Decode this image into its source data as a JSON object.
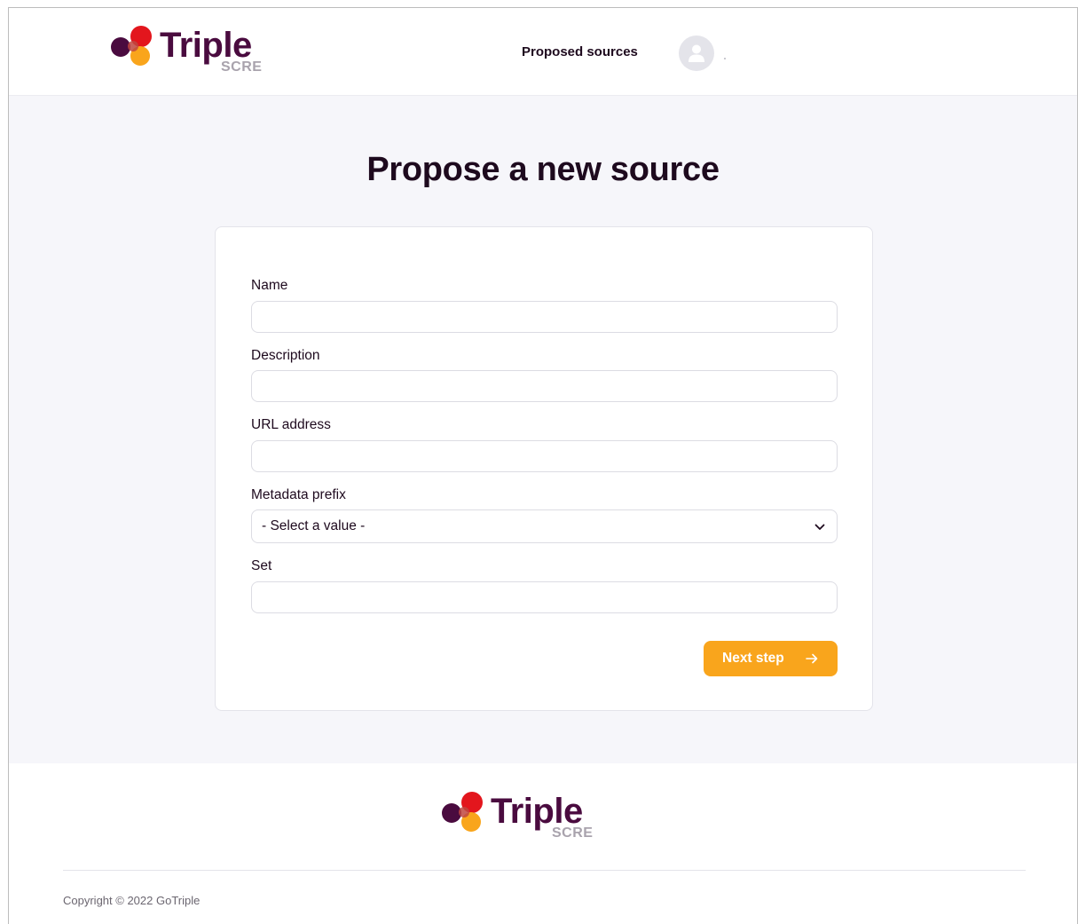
{
  "brand": {
    "name": "Triple",
    "sub": "SCRE",
    "colors": {
      "red": "#e3161d",
      "purple": "#4a0b3f",
      "orange": "#f9a51c",
      "grey": "#a9a3ad"
    }
  },
  "header": {
    "nav_link": "Proposed sources",
    "avatar_icon": "user-icon"
  },
  "main": {
    "title": "Propose a new source",
    "form": {
      "name": {
        "label": "Name",
        "value": ""
      },
      "description": {
        "label": "Description",
        "value": ""
      },
      "url": {
        "label": "URL address",
        "value": ""
      },
      "metadata_prefix": {
        "label": "Metadata prefix",
        "selected": "- Select a value -"
      },
      "set": {
        "label": "Set",
        "value": ""
      },
      "next_button": "Next step"
    }
  },
  "footer": {
    "copyright": "Copyright © 2022 GoTriple"
  },
  "colors": {
    "background": "#f6f6fa",
    "accent": "#f9a51c",
    "text": "#1e0a1e"
  }
}
